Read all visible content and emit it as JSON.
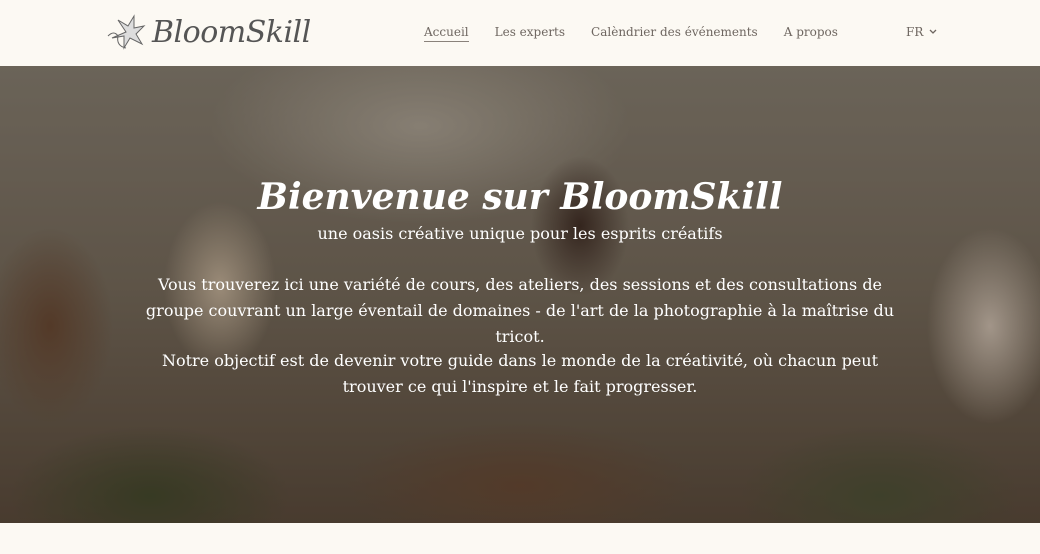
{
  "header": {
    "logo": "BloomSkill",
    "nav": [
      {
        "label": "Accueil",
        "active": true
      },
      {
        "label": "Les experts"
      },
      {
        "label": "Calèndrier des événements"
      },
      {
        "label": "A propos"
      }
    ],
    "lang": "FR"
  },
  "hero": {
    "title": "Bienvenue sur BloomSkill",
    "subtitle": "une oasis créative unique pour les esprits créatifs",
    "paragraph1": "Vous trouverez ici une variété de cours, des ateliers, des sessions et des consultations de groupe couvrant un large éventail de domaines - de l'art de la photographie à la maîtrise du tricot.",
    "paragraph2": "Notre objectif est de devenir votre guide dans le monde de la créativité, où chacun peut trouver ce qui l'inspire et le fait progresser."
  }
}
